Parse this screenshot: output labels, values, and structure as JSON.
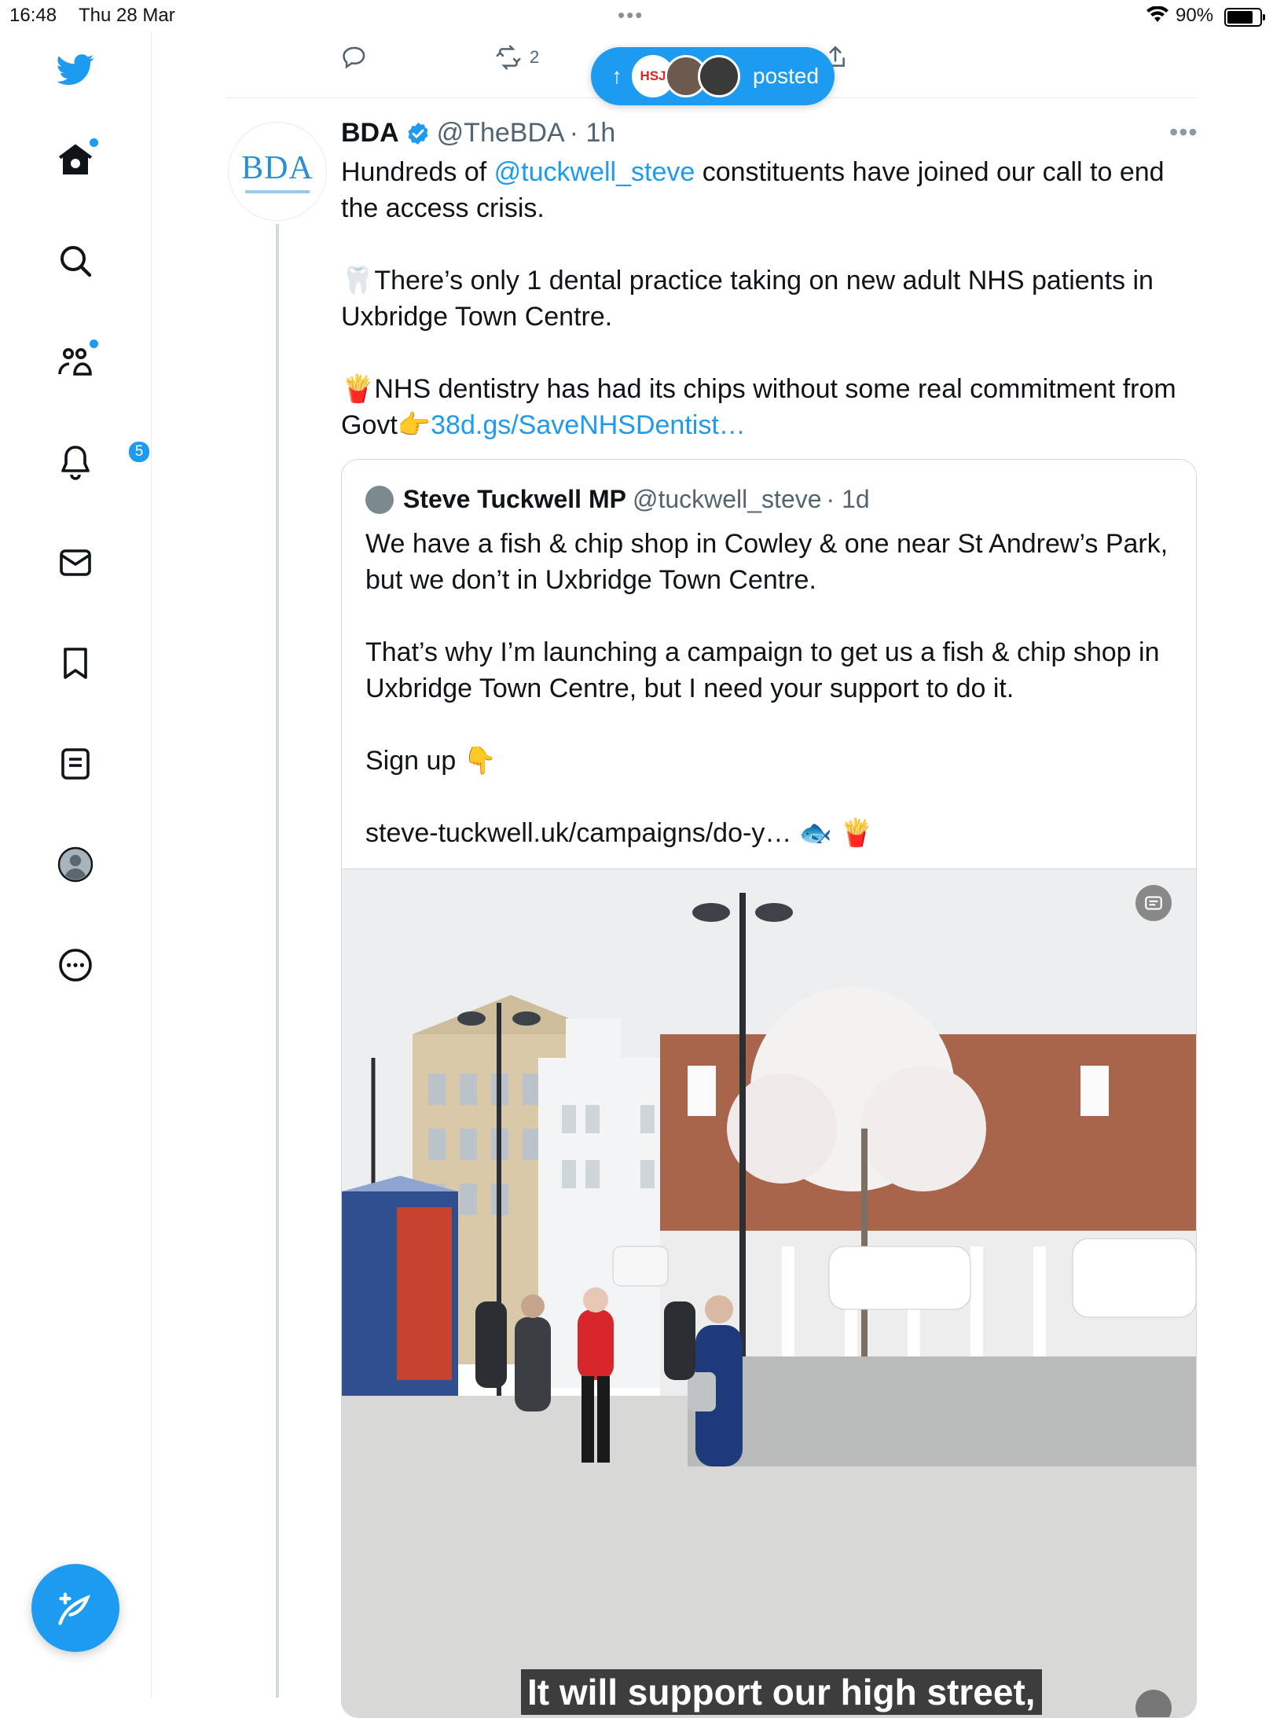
{
  "status_bar": {
    "time": "16:48",
    "date": "Thu 28 Mar",
    "battery": "90%",
    "battery_level": 0.9
  },
  "sidebar": {
    "notifications_count": "5",
    "icons": [
      "twitter-logo",
      "home-icon",
      "search-icon",
      "communities-icon",
      "bell-icon",
      "mail-icon",
      "bookmark-icon",
      "lists-icon",
      "profile-icon",
      "more-icon",
      "compose-icon"
    ]
  },
  "prev_tweet_actions": {
    "retweet_count": "2"
  },
  "new_posts_pill": {
    "label": "posted",
    "avatar_text": "HSJ"
  },
  "tweet": {
    "name": "BDA",
    "handle": "@TheBDA",
    "time": "· 1h",
    "avatar_text": "BDA",
    "text_1a": "Hundreds of ",
    "mention": "@tuckwell_steve",
    "text_1b": " constituents have joined our call to end the access crisis.",
    "text_2": "🦷There’s only 1 dental practice taking on new adult NHS patients in Uxbridge Town Centre.",
    "text_3a": "🍟NHS dentistry has had its chips without some real commitment from Govt👉",
    "link": "38d.gs/SaveNHSDentist…"
  },
  "quote": {
    "name": "Steve Tuckwell MP",
    "handle": "@tuckwell_steve",
    "time": "· 1d",
    "text_1": "We have a fish & chip shop in Cowley & one near St Andrew’s Park, but we don’t in Uxbridge Town Centre.",
    "text_2": "That’s why I’m launching a campaign to get us a fish & chip shop in Uxbridge Town Centre, but I need your support to do it.",
    "text_3": "Sign up  👇",
    "text_4": "steve-tuckwell.uk/campaigns/do-y…  🐟  🍟",
    "video_caption": "It will support our high street,"
  },
  "colors": {
    "accent": "#1d9bf0",
    "text": "#0f1419",
    "muted": "#536471"
  }
}
